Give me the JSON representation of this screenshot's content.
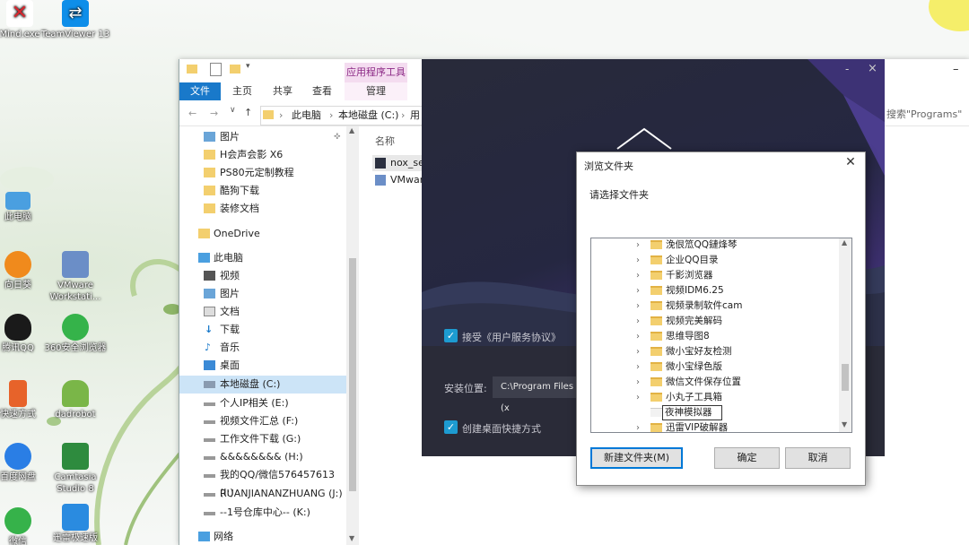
{
  "desktop": {
    "icons": [
      {
        "label": "Mind.exe",
        "color": "#d9262e"
      },
      {
        "label": "TeamViewer 13",
        "color": "#0e8ee9"
      },
      {
        "label": "此电脑",
        "color": "#4a9fe0"
      },
      {
        "label": "向日葵",
        "color": "#f08a1c"
      },
      {
        "label": "VMware Workstati...",
        "color": "#6b8ec7"
      },
      {
        "label": "腾讯QQ",
        "color": "#1a1a1a"
      },
      {
        "label": "360安全浏览器",
        "color": "#35b34a"
      },
      {
        "label": "快速方式",
        "color": "#e7632a"
      },
      {
        "label": "dadrobot",
        "color": "#7ab648"
      },
      {
        "label": "百度网盘",
        "color": "#2a7ee5"
      },
      {
        "label": "Camtasia Studio 8",
        "color": "#2e8b3e"
      },
      {
        "label": "微信",
        "color": "#36b24a"
      },
      {
        "label": "迅雷极速版",
        "color": "#2a8be0"
      }
    ]
  },
  "explorer": {
    "ribbon": {
      "file": "文件",
      "home": "主页",
      "share": "共享",
      "view": "查看",
      "context_group": "应用程序工具",
      "manage": "管理"
    },
    "address": {
      "crumbs": [
        "此电脑",
        "本地磁盘 (C:)",
        "用"
      ],
      "search_placeholder": "搜索\"Programs\""
    },
    "content": {
      "column_name": "名称",
      "files": [
        "nox_set",
        "VMware"
      ]
    },
    "nav": {
      "quick": [
        "图片",
        "H会声会影 X6",
        "PS80元定制教程",
        "酷狗下载",
        "装修文档"
      ],
      "onedrive": "OneDrive",
      "thispc": "此电脑",
      "pc_items": [
        "视频",
        "图片",
        "文档",
        "下载",
        "音乐",
        "桌面"
      ],
      "drives": [
        "本地磁盘 (C:)",
        "个人IP相关 (E:)",
        "视频文件汇总 (F:)",
        "工作文件下载 (G:)",
        "&&&&&&&& (H:)",
        "我的QQ/微信576457613 (I:)",
        "RUANJIANANZHUANG (J:)",
        "--1号仓库中心-- (K:)"
      ],
      "network": "网络"
    }
  },
  "installer": {
    "agree_text": "接受《用户服务协议》",
    "install_location_label": "安装位置:",
    "install_path": "C:\\Program Files (x",
    "desktop_shortcut_text": "创建桌面快捷方式",
    "minimize": "-",
    "close": "×"
  },
  "dialog": {
    "title": "浏览文件夹",
    "close": "✕",
    "prompt": "请选择文件夹",
    "folders": [
      "浼佷笟QQ鏈烽棽",
      "企业QQ目录",
      "千影浏览器",
      "视频IDM6.25",
      "视频录制软件cam",
      "视频完美解码",
      "思维导图8",
      "微小宝好友检测",
      "微小宝绿色版",
      "微信文件保存位置",
      "小丸子工具箱"
    ],
    "editing_name": "夜神模拟器",
    "after_folder": "迅雷VIP破解器",
    "buttons": {
      "new_folder": "新建文件夹(M)",
      "ok": "确定",
      "cancel": "取消"
    }
  }
}
